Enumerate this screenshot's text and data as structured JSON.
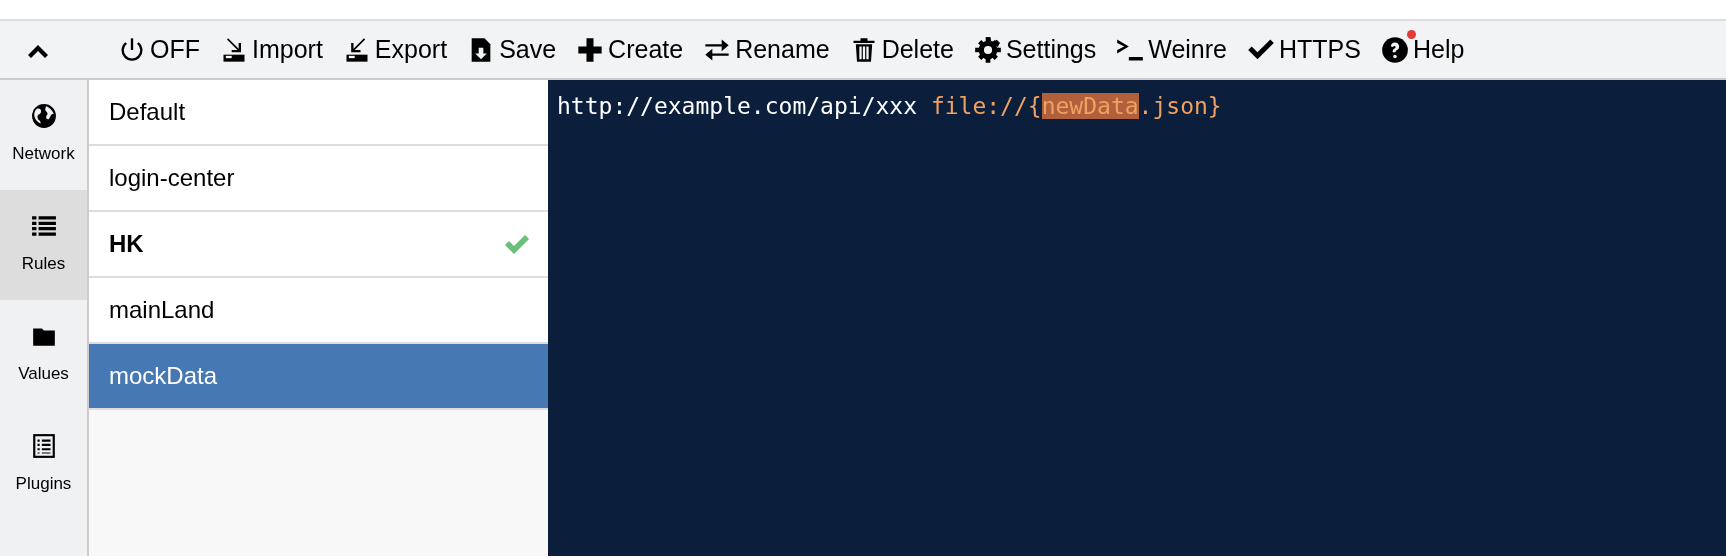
{
  "toolbar": {
    "collapse_button": {
      "expanded": true
    },
    "items": [
      {
        "label": "OFF"
      },
      {
        "label": "Import"
      },
      {
        "label": "Export"
      },
      {
        "label": "Save"
      },
      {
        "label": "Create"
      },
      {
        "label": "Rename"
      },
      {
        "label": "Delete"
      },
      {
        "label": "Settings"
      },
      {
        "label": "Weinre"
      },
      {
        "label": "HTTPS"
      },
      {
        "label": "Help",
        "notification": true
      }
    ]
  },
  "sidebar": {
    "items": [
      {
        "label": "Network",
        "selected": false
      },
      {
        "label": "Rules",
        "selected": true
      },
      {
        "label": "Values",
        "selected": false
      },
      {
        "label": "Plugins",
        "selected": false
      }
    ]
  },
  "rules": [
    {
      "name": "Default",
      "active": false,
      "selected": false
    },
    {
      "name": "login-center",
      "active": false,
      "selected": false
    },
    {
      "name": "HK",
      "active": true,
      "selected": false
    },
    {
      "name": "mainLand",
      "active": false,
      "selected": false
    },
    {
      "name": "mockData",
      "active": false,
      "selected": true
    }
  ],
  "editor": {
    "lines": [
      {
        "segments": [
          {
            "text": "http://example.com/api/xxx ",
            "kind": "pattern",
            "highlighted": false
          },
          {
            "text": "file://{",
            "kind": "operation",
            "highlighted": false
          },
          {
            "text": "newData",
            "kind": "operation",
            "highlighted": true
          },
          {
            "text": ".json}",
            "kind": "operation",
            "highlighted": false
          }
        ]
      }
    ]
  }
}
